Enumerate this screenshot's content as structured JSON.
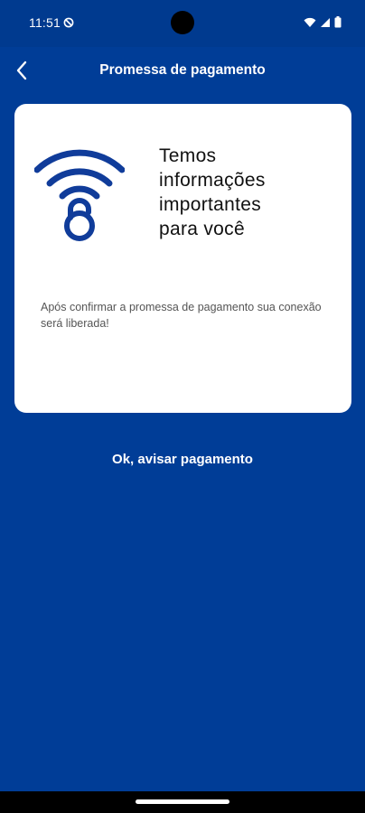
{
  "status_bar": {
    "time": "11:51",
    "icons": [
      "do-not-disturb-icon",
      "wifi-icon",
      "signal-icon",
      "battery-icon"
    ]
  },
  "app_bar": {
    "title": "Promessa de pagamento",
    "back_icon": "chevron-left-icon"
  },
  "card": {
    "icon": "wifi-lock-icon",
    "heading": "Temos\n informações\n importantes\n para você",
    "body": "Após confirmar a promessa de pagamento sua conexão será liberada!"
  },
  "actions": {
    "confirm_label": "Ok, avisar pagamento"
  },
  "colors": {
    "primary_background": "#003d97",
    "card_background": "#ffffff",
    "icon_blue": "#103c9a"
  }
}
